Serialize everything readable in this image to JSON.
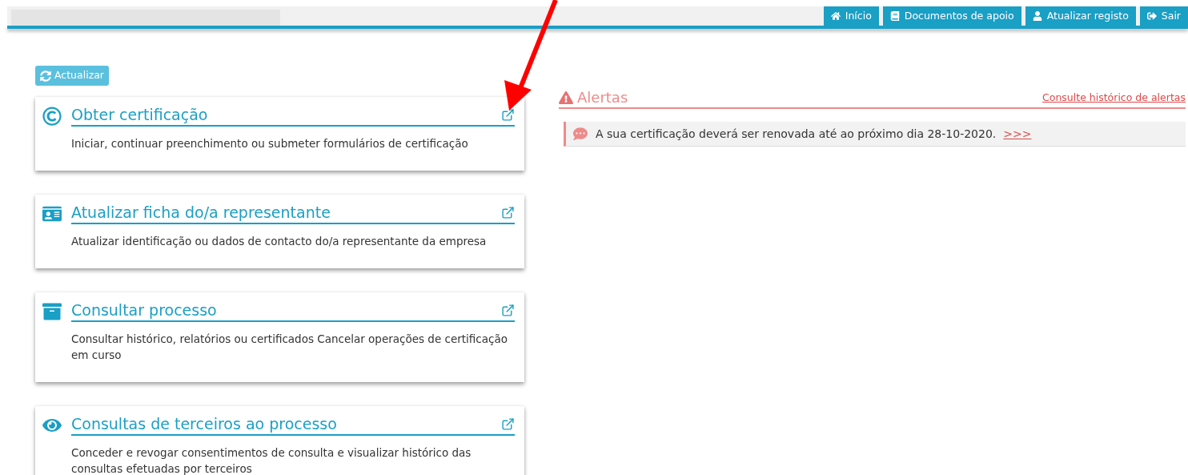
{
  "nav": [
    {
      "kind": "home",
      "label": "Início"
    },
    {
      "kind": "book",
      "label": "Documentos de apoio"
    },
    {
      "kind": "user",
      "label": "Atualizar registo"
    },
    {
      "kind": "exit",
      "label": "Sair"
    }
  ],
  "refresh_button": "Actualizar",
  "cards": [
    {
      "kind": "copyright",
      "title": "Obter certificação",
      "description": "Iniciar, continuar preenchimento ou submeter formulários de certificação"
    },
    {
      "kind": "idcard",
      "title": "Atualizar ficha do/a representante",
      "description": "Atualizar identificação ou dados de contacto do/a representante da empresa"
    },
    {
      "kind": "archive",
      "title": "Consultar processo",
      "description": "Consultar histórico, relatórios ou certificados Cancelar operações de certificação em curso"
    },
    {
      "kind": "eye",
      "title": "Consultas de terceiros ao processo",
      "description": "Conceder e revogar consentimentos de consulta e visualizar histórico das consultas efetuadas por terceiros"
    }
  ],
  "alerts": {
    "title": "Alertas",
    "history_link": "Consulte histórico de alertas",
    "items": [
      {
        "text": "A sua certificação deverá ser renovada até ao próximo dia 28-10-2020.",
        "link": ">>>"
      }
    ]
  }
}
